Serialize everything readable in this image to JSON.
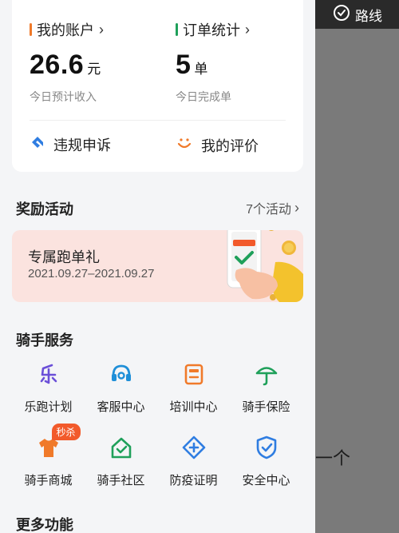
{
  "account": {
    "label": "我的账户",
    "value": "26.6",
    "unit": "元",
    "sub": "今日预计收入"
  },
  "orders": {
    "label": "订单统计",
    "value": "5",
    "unit": "单",
    "sub": "今日完成单"
  },
  "quick_links": [
    {
      "label": "违规申诉",
      "icon": "appeal-icon"
    },
    {
      "label": "我的评价",
      "icon": "smile-icon"
    }
  ],
  "rewards": {
    "title": "奖励活动",
    "link": "7个活动",
    "promo_title": "专属跑单礼",
    "promo_date": "2021.09.27–2021.09.27"
  },
  "services": {
    "title": "骑手服务",
    "items": [
      {
        "label": "乐跑计划",
        "icon": "lepao-icon"
      },
      {
        "label": "客服中心",
        "icon": "headset-icon"
      },
      {
        "label": "培训中心",
        "icon": "training-icon"
      },
      {
        "label": "骑手保险",
        "icon": "umbrella-icon"
      },
      {
        "label": "骑手商城",
        "icon": "shirt-icon",
        "badge": "秒杀"
      },
      {
        "label": "骑手社区",
        "icon": "home-icon"
      },
      {
        "label": "防疫证明",
        "icon": "medical-icon"
      },
      {
        "label": "安全中心",
        "icon": "shield-icon"
      }
    ]
  },
  "more": {
    "title": "更多功能"
  },
  "overlay": {
    "route_label": "路线",
    "bg_text": "一个"
  },
  "colors": {
    "accent_orange": "#f07a2a",
    "accent_green": "#1fa05a",
    "accent_blue": "#2f7de1",
    "accent_purple": "#6b4fd8"
  }
}
